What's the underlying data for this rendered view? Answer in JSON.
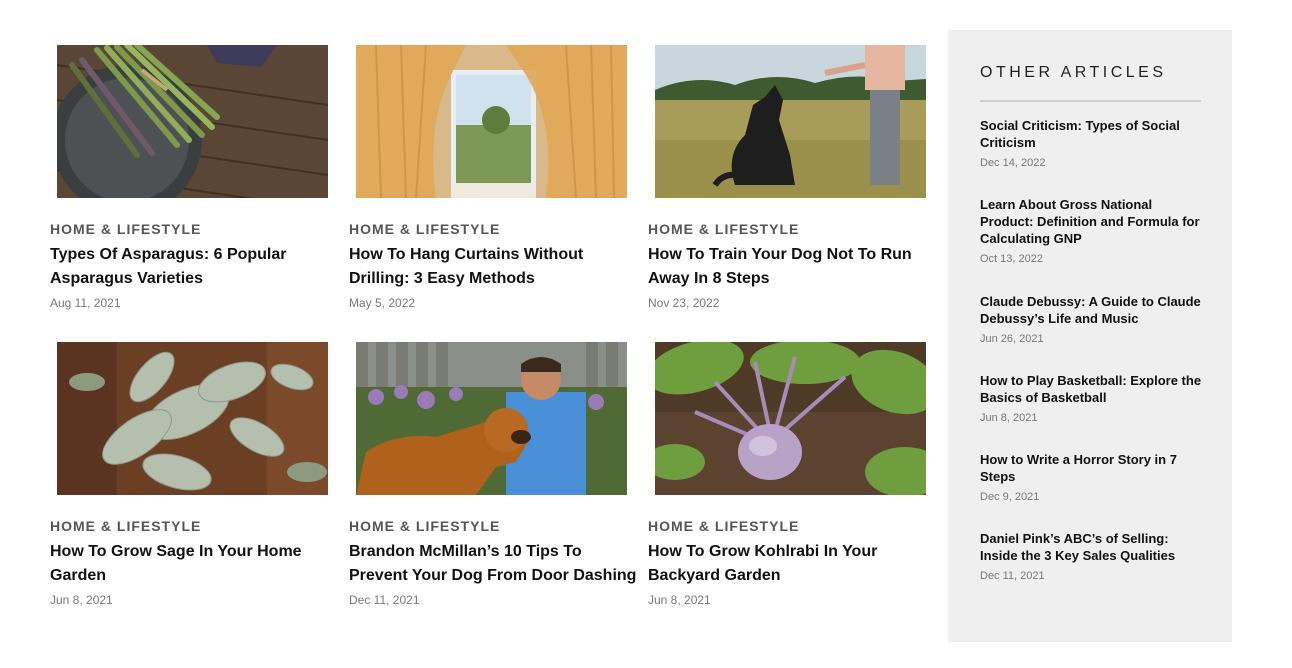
{
  "articles": [
    {
      "category": "HOME & LIFESTYLE",
      "title": "Types Of Asparagus: 6 Popular Asparagus Varieties",
      "date": "Aug 11, 2021",
      "image": "asparagus-photo"
    },
    {
      "category": "HOME & LIFESTYLE",
      "title": "How To Hang Curtains Without Drilling: 3 Easy Methods",
      "date": "May 5, 2022",
      "image": "curtains-window-photo"
    },
    {
      "category": "HOME & LIFESTYLE",
      "title": "How To Train Your Dog Not To Run Away In 8 Steps",
      "date": "Nov 23, 2022",
      "image": "dog-training-photo"
    },
    {
      "category": "HOME & LIFESTYLE",
      "title": "How To Grow Sage In Your Home Garden",
      "date": "Jun 8, 2021",
      "image": "sage-plant-photo"
    },
    {
      "category": "HOME & LIFESTYLE",
      "title": "Brandon McMillan’s 10 Tips To Prevent Your Dog From Door Dashing",
      "date": "Dec 11, 2021",
      "image": "man-with-golden-retriever-photo"
    },
    {
      "category": "HOME & LIFESTYLE",
      "title": "How To Grow Kohlrabi In Your Backyard Garden",
      "date": "Jun 8, 2021",
      "image": "kohlrabi-photo"
    }
  ],
  "sidebar": {
    "heading": "OTHER ARTICLES",
    "items": [
      {
        "title": "Social Criticism: Types of Social Criticism",
        "date": "Dec 14, 2022"
      },
      {
        "title": "Learn About Gross National Product: Definition and Formula for Calculating GNP",
        "date": "Oct 13, 2022"
      },
      {
        "title": "Claude Debussy: A Guide to Claude Debussy’s Life and Music",
        "date": "Jun 26, 2021"
      },
      {
        "title": "How to Play Basketball: Explore the Basics of Basketball",
        "date": "Jun 8, 2021"
      },
      {
        "title": "How to Write a Horror Story in 7 Steps",
        "date": "Dec 9, 2021"
      },
      {
        "title": "Daniel Pink’s ABC’s of Selling: Inside the 3 Key Sales Qualities",
        "date": "Dec 11, 2021"
      }
    ]
  },
  "colors": {
    "sidebar_bg": "#efefef",
    "category_text": "#555555",
    "date_text": "#777777",
    "title_text": "#111111"
  }
}
